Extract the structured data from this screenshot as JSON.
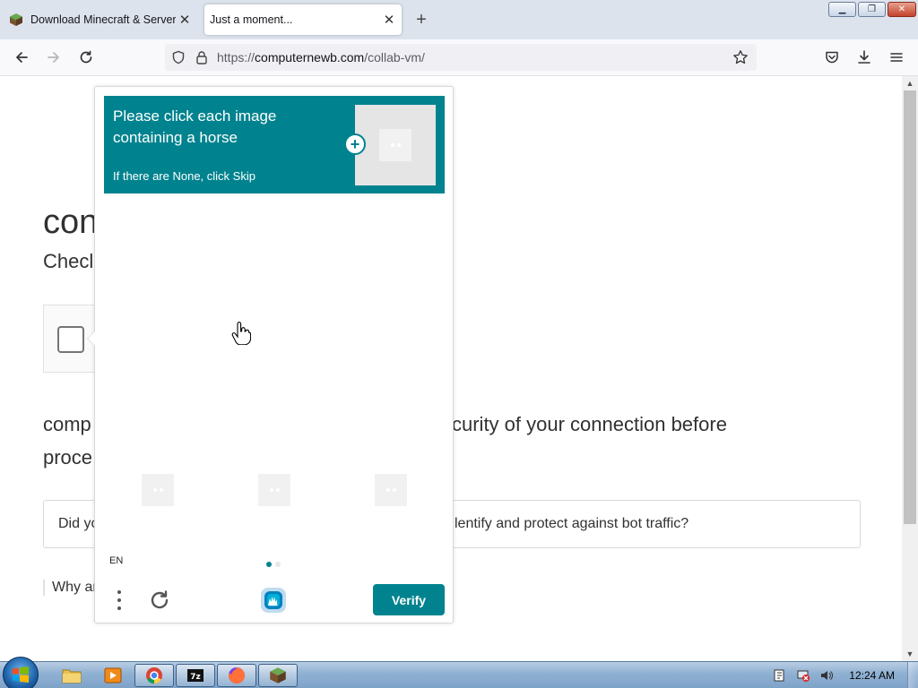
{
  "browser": {
    "tabs": [
      {
        "title": "Download Minecraft & Server Software",
        "favicon": "minecraft-grass-block-icon",
        "active": false
      },
      {
        "title": "Just a moment...",
        "active": true
      }
    ],
    "new_tab_icon": "plus-icon",
    "window_controls": [
      "minimize",
      "restore",
      "close"
    ],
    "nav": {
      "back_icon": "back-arrow-icon",
      "forward_icon": "forward-arrow-icon",
      "reload_icon": "reload-icon",
      "url_scheme": "https://",
      "url_host": "computernewb.com",
      "url_path": "/collab-vm/",
      "bookmark_icon": "star-icon",
      "toolbar_icons": [
        "pocket-icon",
        "download-icon",
        "menu-icon"
      ]
    }
  },
  "page": {
    "heading": "con",
    "subheading": "Checl",
    "paragraph_left_1": "comp",
    "paragraph_right_1": "curity of your connection before",
    "paragraph_left_2": "proce",
    "faq_left": "Did yo",
    "faq_right": "lentify and protect against bot traffic?",
    "why_text": "Why ar"
  },
  "captcha": {
    "prompt": "Please click each image containing a horse",
    "sub_prompt": "If there are None, click Skip",
    "language": "EN",
    "pages": 2,
    "current_page": 1,
    "verify_label": "Verify",
    "colors": {
      "accent": "#00838f"
    }
  },
  "taskbar": {
    "pinned": [
      "start-orb",
      "explorer-icon",
      "media-player-icon",
      "chrome-icon",
      "7zip-icon",
      "firefox-icon",
      "minecraft-icon"
    ],
    "clock": "12:24 AM"
  }
}
